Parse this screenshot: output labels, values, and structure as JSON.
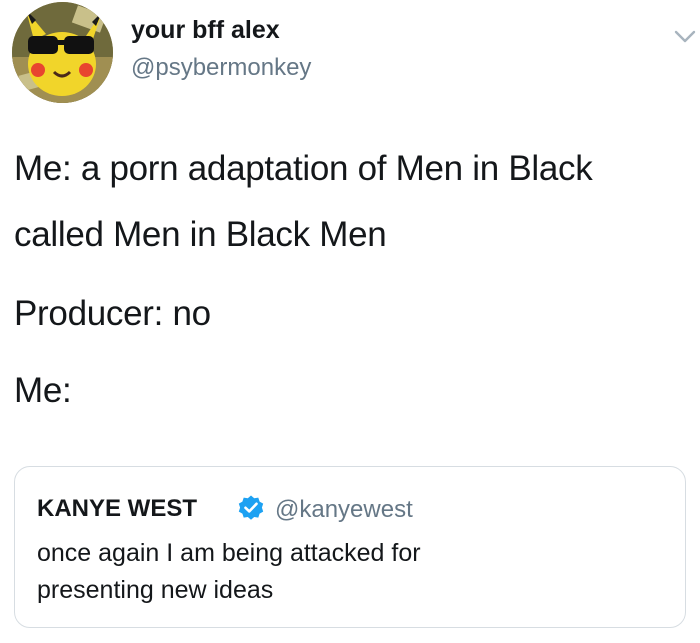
{
  "tweet": {
    "author": {
      "display_name": "your bff alex",
      "handle": "@psybermonkey",
      "avatar_icon": "pikachu-sunglasses-avatar-icon"
    },
    "menu_icon": "chevron-down-icon",
    "lines": [
      "Me: a porn adaptation of Men in Black",
      "called Men in Black Men",
      "Producer: no",
      "Me:"
    ],
    "quoted_tweet": {
      "display_name": "KANYE WEST",
      "verified_icon": "verified-badge-icon",
      "verified_color": "#1da1f2",
      "handle": "@kanyewest",
      "lines": [
        "once again I am being attacked for",
        "presenting new ideas"
      ]
    }
  }
}
